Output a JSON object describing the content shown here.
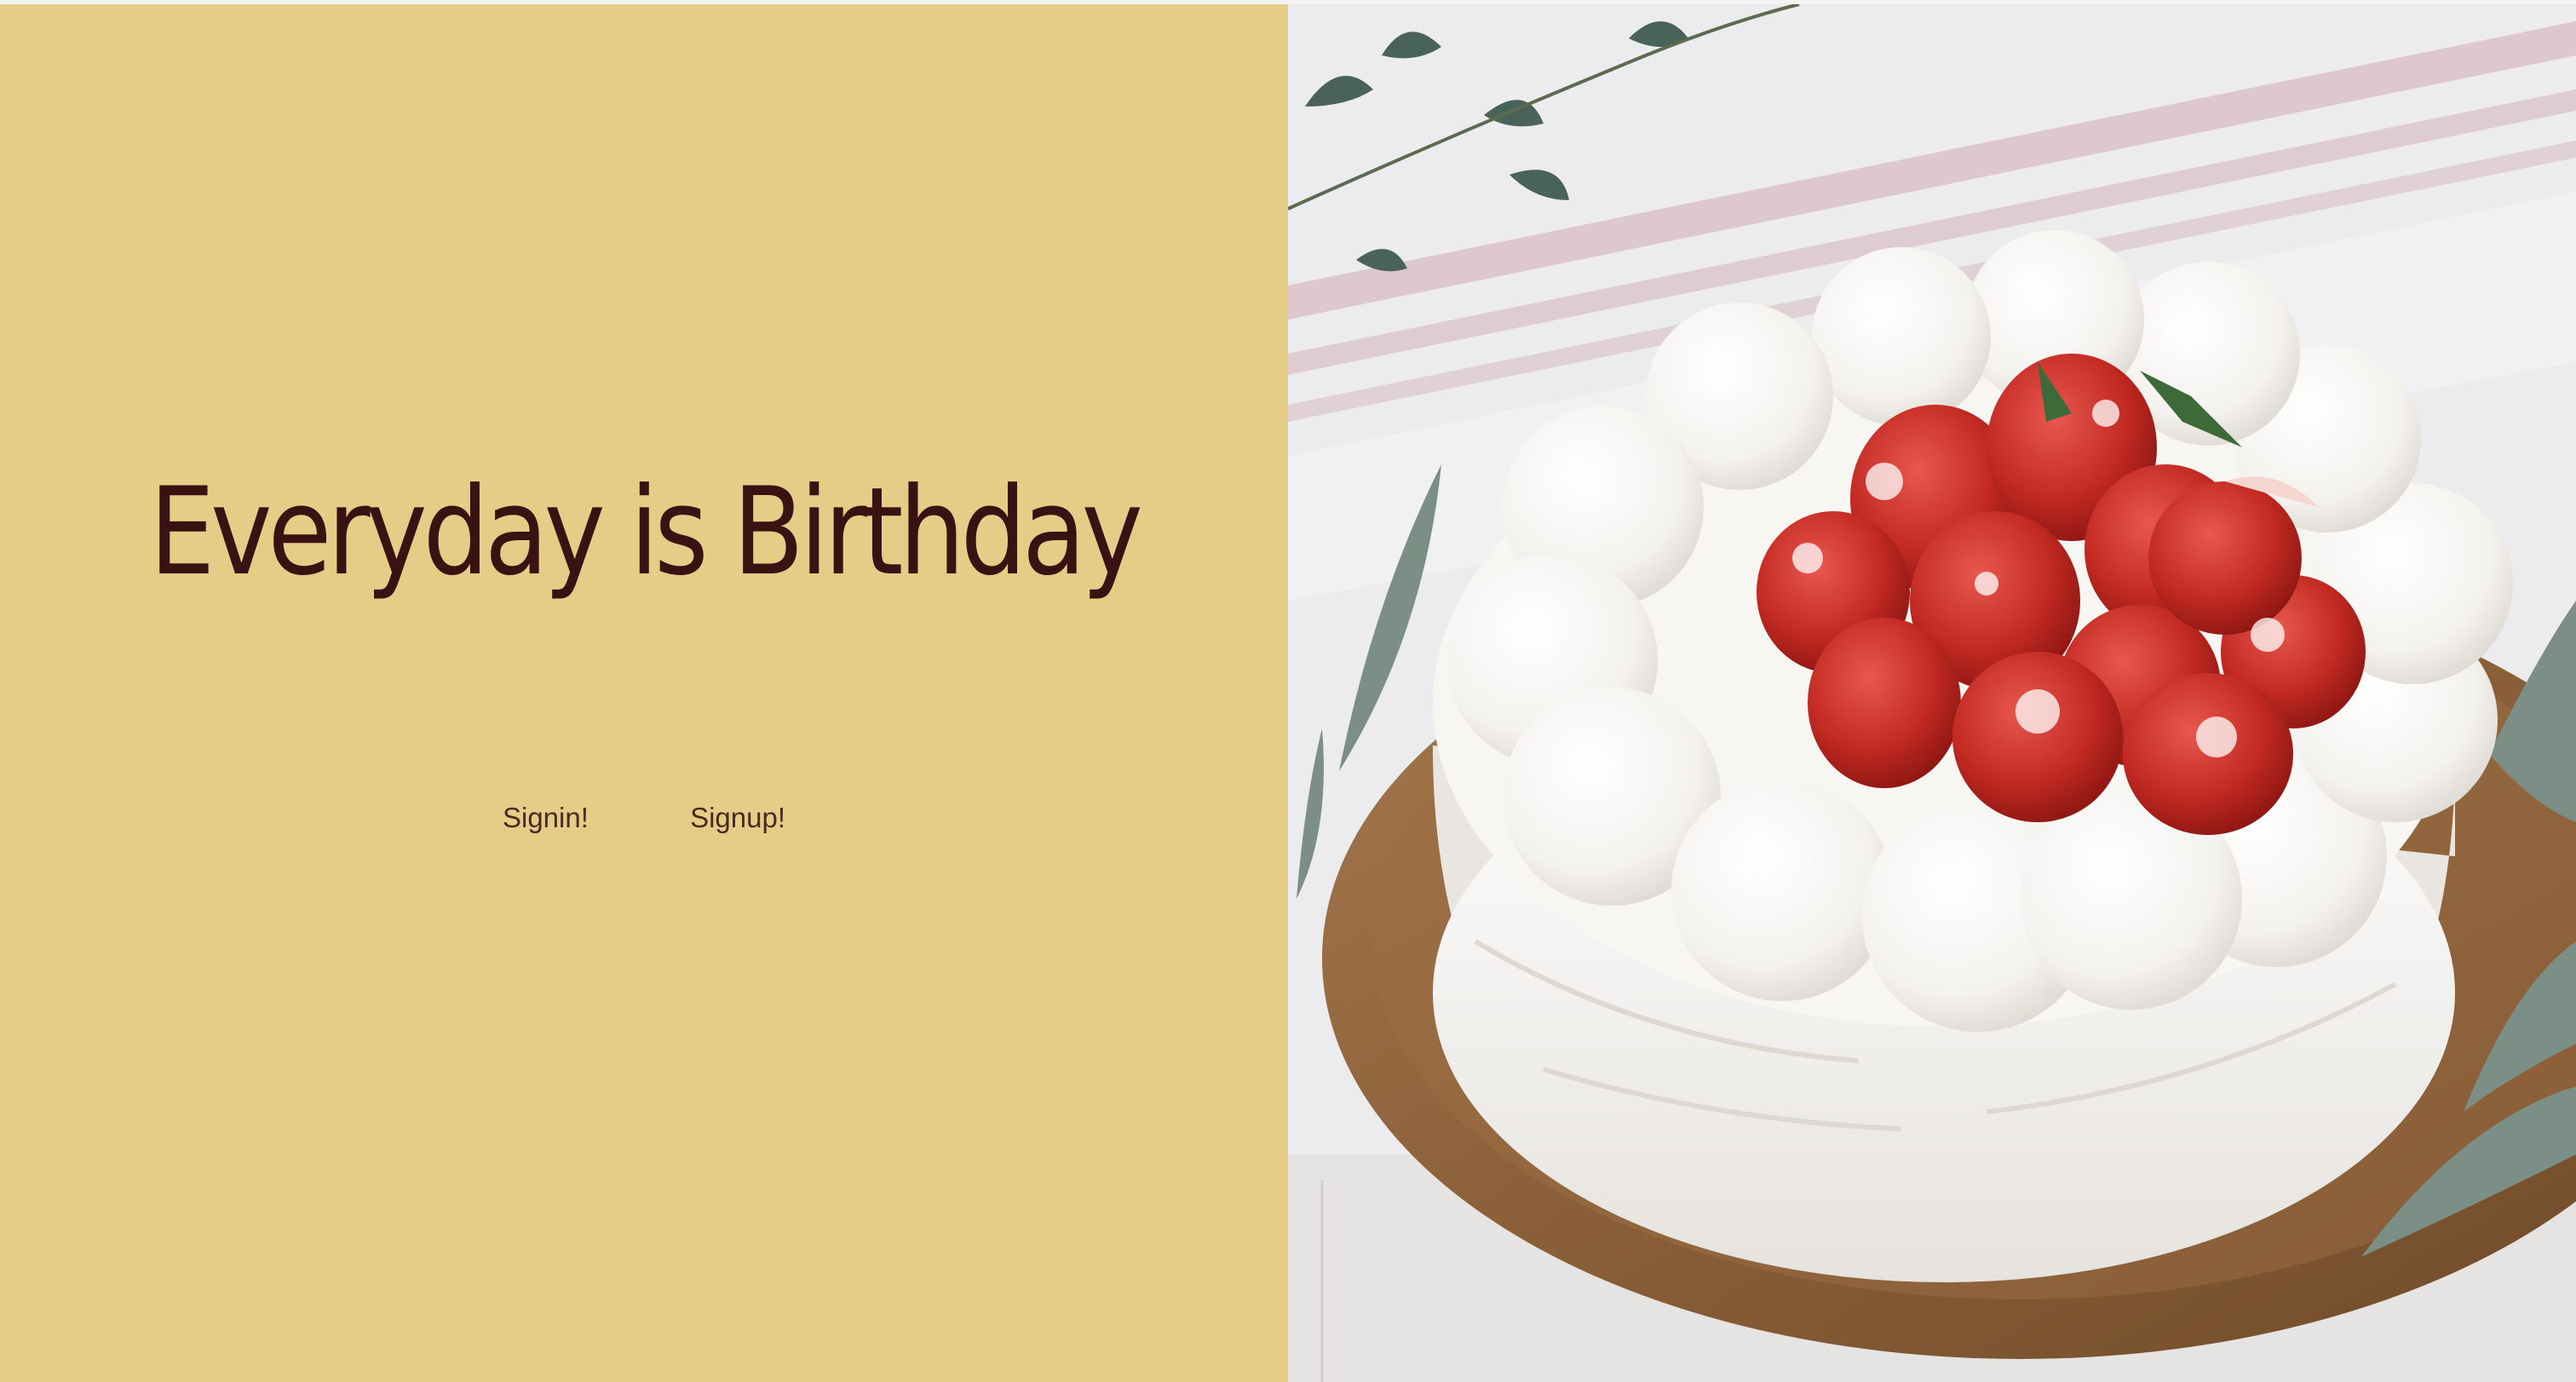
{
  "hero": {
    "title": "Everyday is Birthday"
  },
  "auth": {
    "signin_label": "Signin!",
    "signup_label": "Signup!"
  },
  "photo": {
    "subject": "strawberry-shortcake"
  },
  "colors": {
    "panel_bg": "#e5cd88",
    "title_text": "#3a1212",
    "link_text": "#4a2a20"
  }
}
